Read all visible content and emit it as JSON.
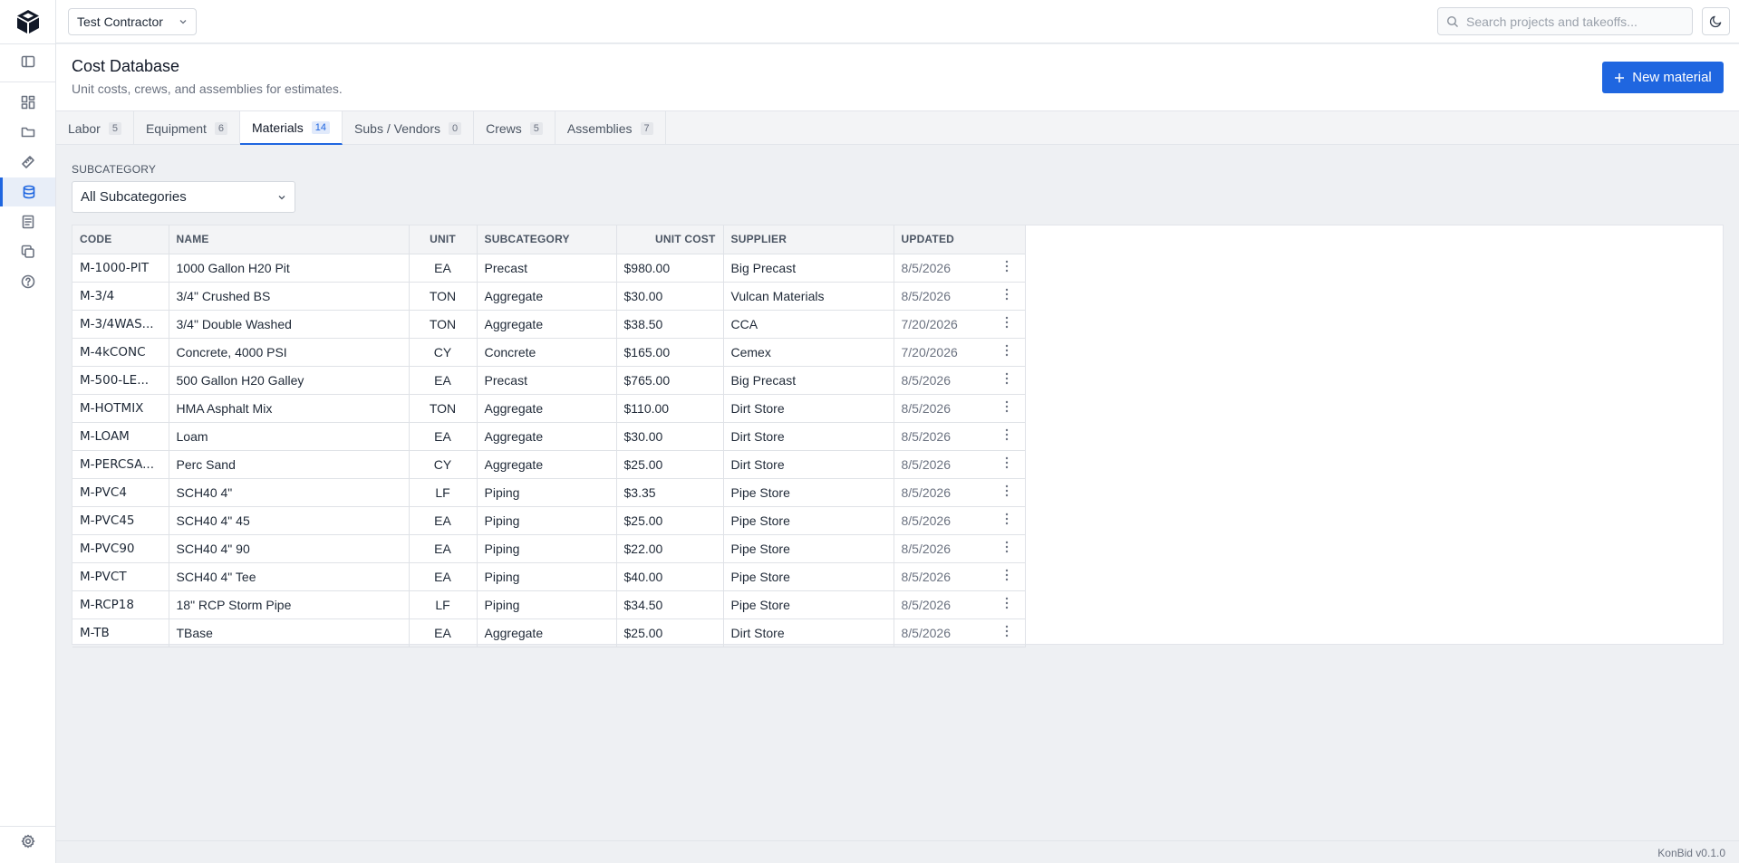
{
  "topbar": {
    "org_name": "Test Contractor",
    "search_placeholder": "Search projects and takeoffs..."
  },
  "header": {
    "title": "Cost Database",
    "subtitle": "Unit costs, crews, and assemblies for estimates.",
    "new_button": "New material"
  },
  "tabs": [
    {
      "label": "Labor",
      "count": "5"
    },
    {
      "label": "Equipment",
      "count": "6"
    },
    {
      "label": "Materials",
      "count": "14",
      "active": true
    },
    {
      "label": "Subs / Vendors",
      "count": "0"
    },
    {
      "label": "Crews",
      "count": "5"
    },
    {
      "label": "Assemblies",
      "count": "7"
    }
  ],
  "filter": {
    "label": "SUBCATEGORY",
    "value": "All Subcategories"
  },
  "table": {
    "columns": [
      "CODE",
      "NAME",
      "UNIT",
      "SUBCATEGORY",
      "UNIT COST",
      "SUPPLIER",
      "UPDATED"
    ],
    "rows": [
      [
        "M-1000-PIT",
        "1000 Gallon H20 Pit",
        "EA",
        "Precast",
        "$980.00",
        "Big Precast",
        "8/5/2026"
      ],
      [
        "M-3/4",
        "3/4\" Crushed BS",
        "TON",
        "Aggregate",
        "$30.00",
        "Vulcan Materials",
        "8/5/2026"
      ],
      [
        "M-3/4WAS...",
        "3/4\" Double Washed",
        "TON",
        "Aggregate",
        "$38.50",
        "CCA",
        "7/20/2026"
      ],
      [
        "M-4kCONC",
        "Concrete, 4000 PSI",
        "CY",
        "Concrete",
        "$165.00",
        "Cemex",
        "7/20/2026"
      ],
      [
        "M-500-LE...",
        "500 Gallon H20 Galley",
        "EA",
        "Precast",
        "$765.00",
        "Big Precast",
        "8/5/2026"
      ],
      [
        "M-HOTMIX",
        "HMA Asphalt Mix",
        "TON",
        "Aggregate",
        "$110.00",
        "Dirt Store",
        "8/5/2026"
      ],
      [
        "M-LOAM",
        "Loam",
        "EA",
        "Aggregate",
        "$30.00",
        "Dirt Store",
        "8/5/2026"
      ],
      [
        "M-PERCSA...",
        "Perc Sand",
        "CY",
        "Aggregate",
        "$25.00",
        "Dirt Store",
        "8/5/2026"
      ],
      [
        "M-PVC4",
        "SCH40 4\"",
        "LF",
        "Piping",
        "$3.35",
        "Pipe Store",
        "8/5/2026"
      ],
      [
        "M-PVC45",
        "SCH40 4\" 45",
        "EA",
        "Piping",
        "$25.00",
        "Pipe Store",
        "8/5/2026"
      ],
      [
        "M-PVC90",
        "SCH40 4\" 90",
        "EA",
        "Piping",
        "$22.00",
        "Pipe Store",
        "8/5/2026"
      ],
      [
        "M-PVCT",
        "SCH40 4\" Tee",
        "EA",
        "Piping",
        "$40.00",
        "Pipe Store",
        "8/5/2026"
      ],
      [
        "M-RCP18",
        "18\" RCP Storm Pipe",
        "LF",
        "Piping",
        "$34.50",
        "Pipe Store",
        "8/5/2026"
      ],
      [
        "M-TB",
        "TBase",
        "EA",
        "Aggregate",
        "$25.00",
        "Dirt Store",
        "8/5/2026"
      ]
    ]
  },
  "footer": {
    "version": "KonBid v0.1.0"
  },
  "colors": {
    "accent": "#1f66e0"
  }
}
